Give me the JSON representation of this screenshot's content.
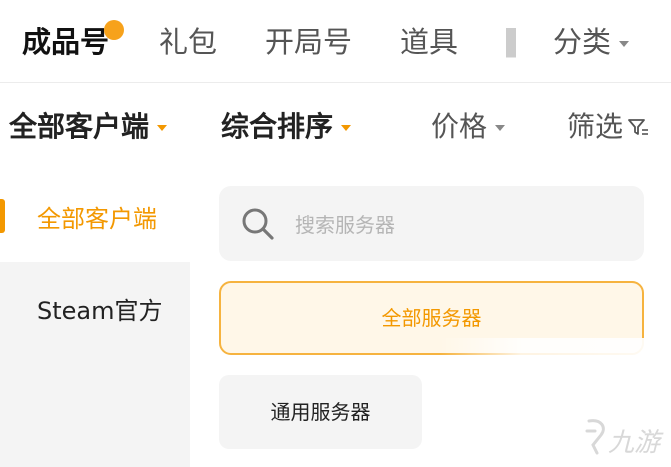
{
  "tabs": [
    {
      "label": "成品号",
      "active": true
    },
    {
      "label": "礼包",
      "active": false
    },
    {
      "label": "开局号",
      "active": false
    },
    {
      "label": "道具",
      "active": false
    },
    {
      "label": "分类",
      "active": false
    }
  ],
  "filters": {
    "client": "全部客户端",
    "sort": "综合排序",
    "price": "价格",
    "screen": "筛选"
  },
  "sidebar": {
    "items": [
      {
        "label": "全部客户端",
        "active": true
      },
      {
        "label": "Steam官方",
        "active": false
      }
    ]
  },
  "search": {
    "placeholder": "搜索服务器",
    "value": ""
  },
  "servers": [
    {
      "label": "全部服务器",
      "selected": true
    },
    {
      "label": "通用服务器",
      "selected": false
    }
  ],
  "watermark": {
    "text": "九游"
  },
  "colors": {
    "accent": "#f39800",
    "accent_dot": "#f7a21b",
    "selected_bg": "#fff7e8",
    "panel_bg": "#f4f4f4"
  }
}
